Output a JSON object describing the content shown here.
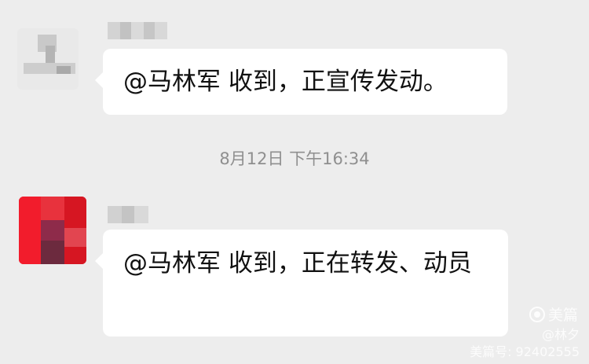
{
  "messages": [
    {
      "text": "@马林军  收到，正宣传发动。"
    },
    {
      "text": "@马林军 收到，正在转发、动员"
    }
  ],
  "timestamp": "8月12日 下午16:34",
  "watermark": {
    "app": "美篇",
    "user": "@林夕",
    "id": "美篇号: 92402555"
  },
  "colors": {
    "background": "#ededed",
    "bubble": "#ffffff",
    "timestamp_text": "#8f8f8f",
    "avatar2_red": "#e01e2a"
  }
}
